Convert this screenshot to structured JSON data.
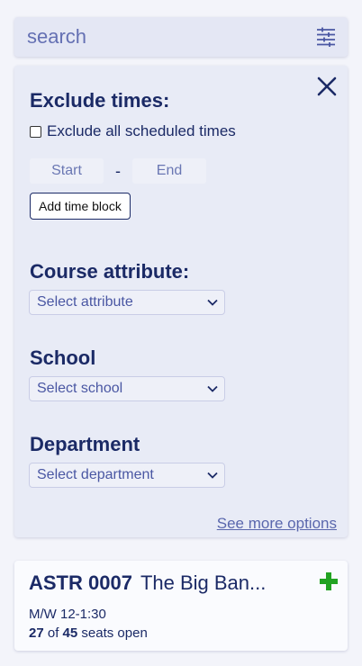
{
  "search": {
    "placeholder": "search"
  },
  "filters": {
    "exclude_times": {
      "title": "Exclude times:",
      "checkbox_label": "Exclude all scheduled times",
      "start_placeholder": "Start",
      "separator": "-",
      "end_placeholder": "End",
      "add_button": "Add time block"
    },
    "course_attribute": {
      "title": "Course attribute:",
      "select": "Select attribute"
    },
    "school": {
      "title": "School",
      "select": "Select school"
    },
    "department": {
      "title": "Department",
      "select": "Select department"
    },
    "see_more": "See more options"
  },
  "course": {
    "code": "ASTR 0007",
    "name": "The Big Ban...",
    "schedule": "M/W 12-1:30",
    "seats_open": "27",
    "seats_of": "of",
    "seats_total": "45",
    "seats_suffix": "seats open"
  },
  "icons": {
    "filter": "sliders-icon",
    "close": "close-icon",
    "add": "plus-icon",
    "chevron": "chevron-down-icon"
  },
  "colors": {
    "primary": "#1b2a66",
    "accent": "#4a57a3",
    "add_green": "#22a322"
  }
}
